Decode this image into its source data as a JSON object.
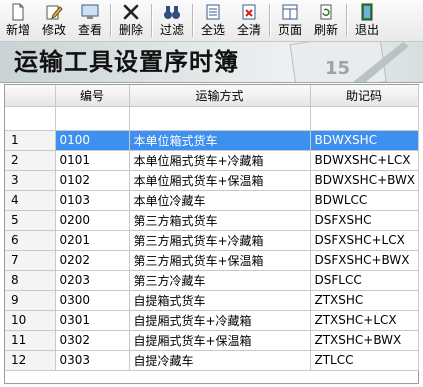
{
  "toolbar": {
    "buttons": [
      {
        "label": "新增",
        "icon": "new-document-icon"
      },
      {
        "label": "修改",
        "icon": "edit-icon"
      },
      {
        "label": "查看",
        "icon": "view-icon"
      },
      {
        "label": "删除",
        "icon": "delete-x-icon"
      },
      {
        "label": "过滤",
        "icon": "binoculars-filter-icon"
      },
      {
        "label": "全选",
        "icon": "select-all-icon"
      },
      {
        "label": "全清",
        "icon": "clear-all-icon"
      },
      {
        "label": "页面",
        "icon": "page-layout-icon"
      },
      {
        "label": "刷新",
        "icon": "refresh-icon"
      },
      {
        "label": "退出",
        "icon": "exit-door-icon"
      }
    ]
  },
  "banner": {
    "title": "运输工具设置序时簿",
    "deco_number": "15"
  },
  "grid": {
    "columns": [
      "编号",
      "运输方式",
      "助记码"
    ],
    "selected_row": 1,
    "selection_color": "#3d8ff0",
    "rows": [
      {
        "n": "1",
        "code": "0100",
        "method": "本单位箱式货车",
        "mnemonic": "BDWXSHC"
      },
      {
        "n": "2",
        "code": "0101",
        "method": "本单位厢式货车+冷藏箱",
        "mnemonic": "BDWXSHC+LCX"
      },
      {
        "n": "3",
        "code": "0102",
        "method": "本单位厢式货车+保温箱",
        "mnemonic": "BDWXSHC+BWX"
      },
      {
        "n": "4",
        "code": "0103",
        "method": "本单位冷藏车",
        "mnemonic": "BDWLCC"
      },
      {
        "n": "5",
        "code": "0200",
        "method": "第三方箱式货车",
        "mnemonic": "DSFXSHC"
      },
      {
        "n": "6",
        "code": "0201",
        "method": "第三方厢式货车+冷藏箱",
        "mnemonic": "DSFXSHC+LCX"
      },
      {
        "n": "7",
        "code": "0202",
        "method": "第三方厢式货车+保温箱",
        "mnemonic": "DSFXSHC+BWX"
      },
      {
        "n": "8",
        "code": "0203",
        "method": "第三方冷藏车",
        "mnemonic": "DSFLCC"
      },
      {
        "n": "9",
        "code": "0300",
        "method": "自提箱式货车",
        "mnemonic": "ZTXSHC"
      },
      {
        "n": "10",
        "code": "0301",
        "method": "自提厢式货车+冷藏箱",
        "mnemonic": "ZTXSHC+LCX"
      },
      {
        "n": "11",
        "code": "0302",
        "method": "自提厢式货车+保温箱",
        "mnemonic": "ZTXSHC+BWX"
      },
      {
        "n": "12",
        "code": "0303",
        "method": "自提冷藏车",
        "mnemonic": "ZTLCC"
      }
    ]
  }
}
